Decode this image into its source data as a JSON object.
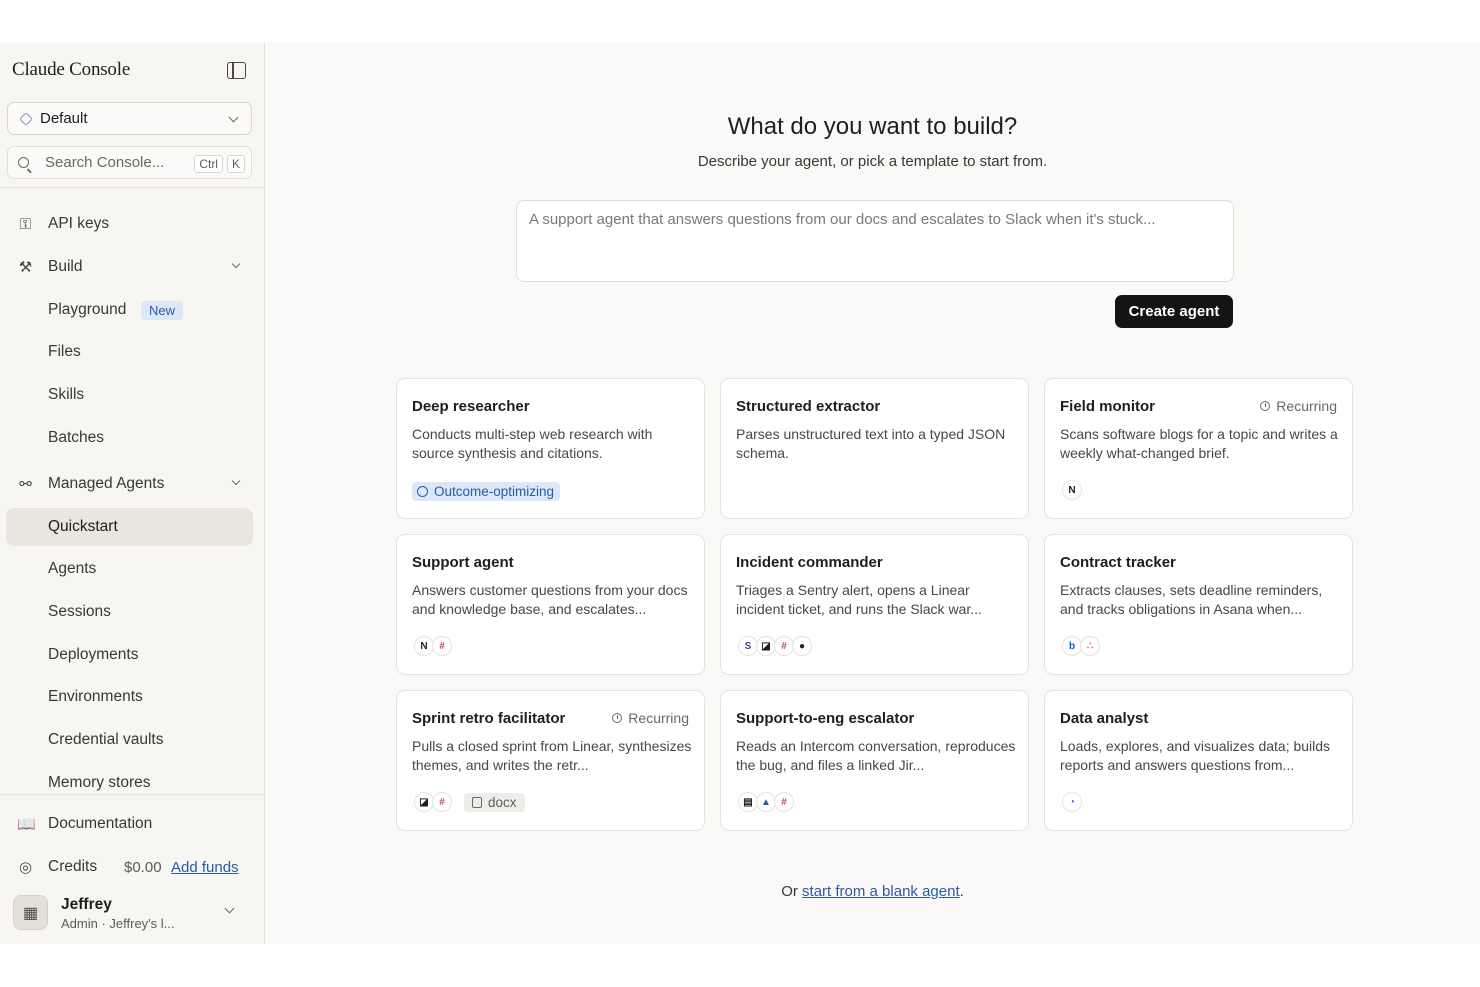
{
  "sidebar": {
    "brand": "Claude Console",
    "workspace": "Default",
    "search_placeholder": "Search Console...",
    "shortcut": [
      "Ctrl",
      "K"
    ],
    "items": {
      "api_keys": "API keys",
      "build": "Build",
      "playground": "Playground",
      "new_badge": "New",
      "files": "Files",
      "skills": "Skills",
      "batches": "Batches",
      "managed_agents": "Managed Agents",
      "quickstart": "Quickstart",
      "agents": "Agents",
      "sessions": "Sessions",
      "deployments": "Deployments",
      "environments": "Environments",
      "credential_vaults": "Credential vaults",
      "memory_stores": "Memory stores"
    },
    "documentation": "Documentation",
    "credits": "Credits",
    "credits_amount": "$0.00",
    "add_funds": "Add funds",
    "user": {
      "name": "Jeffrey",
      "role": "Admin · Jeffrey's l..."
    }
  },
  "main": {
    "title": "What do you want to build?",
    "subtitle": "Describe your agent, or pick a template to start from.",
    "prompt_placeholder": "A support agent that answers questions from our docs and escalates to Slack when it's stuck...",
    "create_button": "Create agent",
    "footer_prefix": "Or ",
    "footer_link": "start from a blank agent",
    "footer_suffix": "."
  },
  "templates": [
    {
      "title": "Deep researcher",
      "desc": "Conducts multi-step web research with source synthesis and citations.",
      "tag": "Outcome-optimizing",
      "recurring": "",
      "icons": []
    },
    {
      "title": "Structured extractor",
      "desc": "Parses unstructured text into a typed JSON schema.",
      "tag": "",
      "recurring": "",
      "icons": []
    },
    {
      "title": "Field monitor",
      "desc": "Scans software blogs for a topic and writes a weekly what-changed brief.",
      "tag": "",
      "recurring": "Recurring",
      "icons": [
        "notion-icon"
      ]
    },
    {
      "title": "Support agent",
      "desc": "Answers customer questions from your docs and knowledge base, and escalates...",
      "tag": "",
      "recurring": "",
      "icons": [
        "notion-icon",
        "slack-icon"
      ]
    },
    {
      "title": "Incident commander",
      "desc": "Triages a Sentry alert, opens a Linear incident ticket, and runs the Slack war...",
      "tag": "",
      "recurring": "",
      "icons": [
        "sentry-icon",
        "linear-icon",
        "slack-icon",
        "github-icon"
      ]
    },
    {
      "title": "Contract tracker",
      "desc": "Extracts clauses, sets deadline reminders, and tracks obligations in Asana when...",
      "tag": "",
      "recurring": "",
      "icons": [
        "box-icon",
        "asana-icon"
      ]
    },
    {
      "title": "Sprint retro facilitator",
      "desc": "Pulls a closed sprint from Linear, synthesizes themes, and writes the retr...",
      "tag": "",
      "recurring": "Recurring",
      "icons": [
        "linear-icon",
        "slack-icon"
      ],
      "file": "docx"
    },
    {
      "title": "Support-to-eng escalator",
      "desc": "Reads an Intercom conversation, reproduces the bug, and files a linked Jir...",
      "tag": "",
      "recurring": "",
      "icons": [
        "intercom-icon",
        "jira-icon",
        "slack-icon"
      ]
    },
    {
      "title": "Data analyst",
      "desc": "Loads, explores, and visualizes data; builds reports and answers questions from...",
      "tag": "",
      "recurring": "",
      "icons": [
        "analytics-icon"
      ]
    }
  ],
  "colors": {
    "accent_link": "#2a5aa8",
    "badge_bg": "#dce8f7",
    "primary_button": "#141413"
  }
}
